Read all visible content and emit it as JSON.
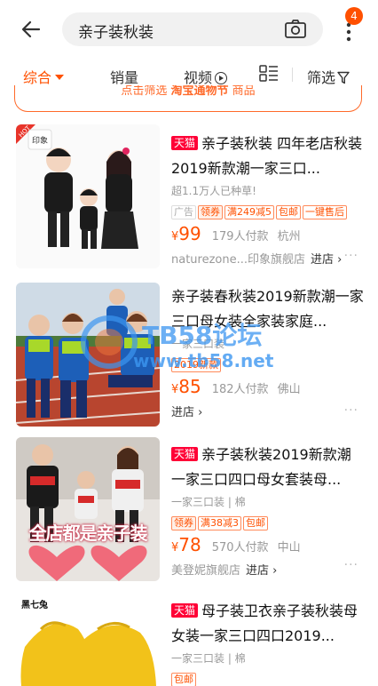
{
  "header": {
    "search_text": "亲子装秋装",
    "badge_count": "4"
  },
  "sort": {
    "items": [
      "综合",
      "销量",
      "视频",
      "筛选"
    ]
  },
  "strip": {
    "text_a": "点击筛选",
    "text_b": "淘宝通物节",
    "text_c": "商品"
  },
  "products": [
    {
      "badge": "天猫",
      "title": "亲子装秋装 四年老店秋装2019新款潮一家三口...",
      "sub": "超1.1万人已种草!",
      "tags": [
        "广告",
        "领券",
        "满249减5",
        "包邮",
        "一键售后"
      ],
      "yen": "¥",
      "price": "99",
      "sales": "179人付款",
      "location": "杭州",
      "shop": "naturezone...印象旗舰店",
      "enter": "进店 ›",
      "thumb_label": "印象"
    },
    {
      "title": "亲子装春秋装2019新款潮一家三口母女装全家装家庭...",
      "sub": "一家三口装",
      "tags": [
        "2019新款"
      ],
      "yen": "¥",
      "price": "85",
      "sales": "182人付款",
      "location": "佛山",
      "enter": "进店 ›"
    },
    {
      "badge": "天猫",
      "title": "亲子装秋装2019新款潮一家三口四口母女套装母...",
      "sub": "一家三口装 | 棉",
      "tags": [
        "领券",
        "满38减3",
        "包邮"
      ],
      "yen": "¥",
      "price": "78",
      "sales": "570人付款",
      "location": "中山",
      "shop": "美登妮旗舰店",
      "enter": "进店 ›",
      "thumb_caption": "全店都是亲子装"
    },
    {
      "badge": "天猫",
      "title": "母子装卫衣亲子装秋装母女装一家三口四口2019...",
      "sub": "一家三口装 | 棉",
      "tags": [
        "包邮"
      ],
      "thumb_label": "黑七兔"
    }
  ],
  "watermark": {
    "line1": "TB58论坛",
    "line2": "www.tb58.net"
  },
  "colors": {
    "accent": "#ff5000",
    "tmall": "#ff0036"
  }
}
